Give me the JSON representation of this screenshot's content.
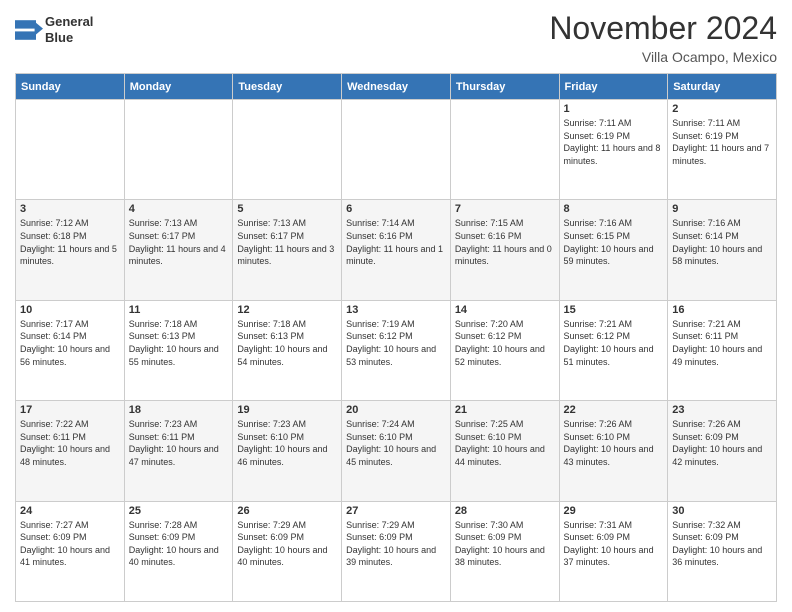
{
  "header": {
    "logo_line1": "General",
    "logo_line2": "Blue",
    "title": "November 2024",
    "subtitle": "Villa Ocampo, Mexico"
  },
  "weekdays": [
    "Sunday",
    "Monday",
    "Tuesday",
    "Wednesday",
    "Thursday",
    "Friday",
    "Saturday"
  ],
  "weeks": [
    [
      {
        "day": "",
        "info": ""
      },
      {
        "day": "",
        "info": ""
      },
      {
        "day": "",
        "info": ""
      },
      {
        "day": "",
        "info": ""
      },
      {
        "day": "",
        "info": ""
      },
      {
        "day": "1",
        "info": "Sunrise: 7:11 AM\nSunset: 6:19 PM\nDaylight: 11 hours and 8 minutes."
      },
      {
        "day": "2",
        "info": "Sunrise: 7:11 AM\nSunset: 6:19 PM\nDaylight: 11 hours and 7 minutes."
      }
    ],
    [
      {
        "day": "3",
        "info": "Sunrise: 7:12 AM\nSunset: 6:18 PM\nDaylight: 11 hours and 5 minutes."
      },
      {
        "day": "4",
        "info": "Sunrise: 7:13 AM\nSunset: 6:17 PM\nDaylight: 11 hours and 4 minutes."
      },
      {
        "day": "5",
        "info": "Sunrise: 7:13 AM\nSunset: 6:17 PM\nDaylight: 11 hours and 3 minutes."
      },
      {
        "day": "6",
        "info": "Sunrise: 7:14 AM\nSunset: 6:16 PM\nDaylight: 11 hours and 1 minute."
      },
      {
        "day": "7",
        "info": "Sunrise: 7:15 AM\nSunset: 6:16 PM\nDaylight: 11 hours and 0 minutes."
      },
      {
        "day": "8",
        "info": "Sunrise: 7:16 AM\nSunset: 6:15 PM\nDaylight: 10 hours and 59 minutes."
      },
      {
        "day": "9",
        "info": "Sunrise: 7:16 AM\nSunset: 6:14 PM\nDaylight: 10 hours and 58 minutes."
      }
    ],
    [
      {
        "day": "10",
        "info": "Sunrise: 7:17 AM\nSunset: 6:14 PM\nDaylight: 10 hours and 56 minutes."
      },
      {
        "day": "11",
        "info": "Sunrise: 7:18 AM\nSunset: 6:13 PM\nDaylight: 10 hours and 55 minutes."
      },
      {
        "day": "12",
        "info": "Sunrise: 7:18 AM\nSunset: 6:13 PM\nDaylight: 10 hours and 54 minutes."
      },
      {
        "day": "13",
        "info": "Sunrise: 7:19 AM\nSunset: 6:12 PM\nDaylight: 10 hours and 53 minutes."
      },
      {
        "day": "14",
        "info": "Sunrise: 7:20 AM\nSunset: 6:12 PM\nDaylight: 10 hours and 52 minutes."
      },
      {
        "day": "15",
        "info": "Sunrise: 7:21 AM\nSunset: 6:12 PM\nDaylight: 10 hours and 51 minutes."
      },
      {
        "day": "16",
        "info": "Sunrise: 7:21 AM\nSunset: 6:11 PM\nDaylight: 10 hours and 49 minutes."
      }
    ],
    [
      {
        "day": "17",
        "info": "Sunrise: 7:22 AM\nSunset: 6:11 PM\nDaylight: 10 hours and 48 minutes."
      },
      {
        "day": "18",
        "info": "Sunrise: 7:23 AM\nSunset: 6:11 PM\nDaylight: 10 hours and 47 minutes."
      },
      {
        "day": "19",
        "info": "Sunrise: 7:23 AM\nSunset: 6:10 PM\nDaylight: 10 hours and 46 minutes."
      },
      {
        "day": "20",
        "info": "Sunrise: 7:24 AM\nSunset: 6:10 PM\nDaylight: 10 hours and 45 minutes."
      },
      {
        "day": "21",
        "info": "Sunrise: 7:25 AM\nSunset: 6:10 PM\nDaylight: 10 hours and 44 minutes."
      },
      {
        "day": "22",
        "info": "Sunrise: 7:26 AM\nSunset: 6:10 PM\nDaylight: 10 hours and 43 minutes."
      },
      {
        "day": "23",
        "info": "Sunrise: 7:26 AM\nSunset: 6:09 PM\nDaylight: 10 hours and 42 minutes."
      }
    ],
    [
      {
        "day": "24",
        "info": "Sunrise: 7:27 AM\nSunset: 6:09 PM\nDaylight: 10 hours and 41 minutes."
      },
      {
        "day": "25",
        "info": "Sunrise: 7:28 AM\nSunset: 6:09 PM\nDaylight: 10 hours and 40 minutes."
      },
      {
        "day": "26",
        "info": "Sunrise: 7:29 AM\nSunset: 6:09 PM\nDaylight: 10 hours and 40 minutes."
      },
      {
        "day": "27",
        "info": "Sunrise: 7:29 AM\nSunset: 6:09 PM\nDaylight: 10 hours and 39 minutes."
      },
      {
        "day": "28",
        "info": "Sunrise: 7:30 AM\nSunset: 6:09 PM\nDaylight: 10 hours and 38 minutes."
      },
      {
        "day": "29",
        "info": "Sunrise: 7:31 AM\nSunset: 6:09 PM\nDaylight: 10 hours and 37 minutes."
      },
      {
        "day": "30",
        "info": "Sunrise: 7:32 AM\nSunset: 6:09 PM\nDaylight: 10 hours and 36 minutes."
      }
    ]
  ]
}
